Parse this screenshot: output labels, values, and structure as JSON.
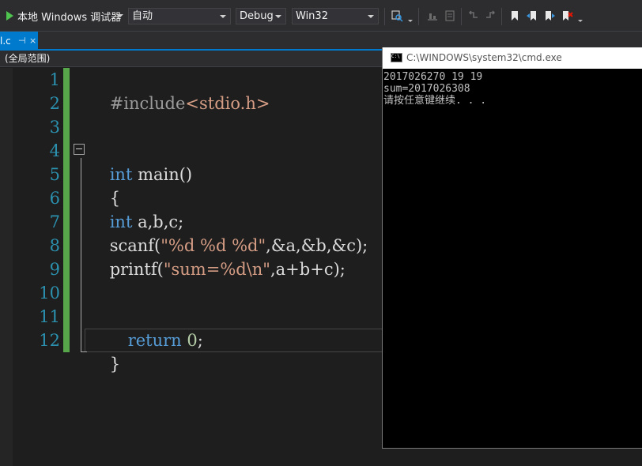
{
  "toolbar": {
    "run_label": "本地 Windows 调试器",
    "config_combo": "自动",
    "build_config": "Debug",
    "platform": "Win32",
    "icons": [
      "find-in-files-icon",
      "format-icon",
      "comment-icon",
      "bookmark-icon",
      "prev-bookmark-icon",
      "next-bookmark-icon",
      "clear-bookmarks-icon"
    ]
  },
  "tab": {
    "file_name": "l.c",
    "pin_glyph": "⊣",
    "close_glyph": "×"
  },
  "navbar": {
    "scope": "(全局范围)"
  },
  "editor": {
    "line_numbers": [
      "1",
      "2",
      "3",
      "4",
      "5",
      "6",
      "7",
      "8",
      "9",
      "10",
      "11",
      "12"
    ],
    "lines": {
      "l1_directive": "#include",
      "l1_header": "<stdio.h>",
      "l4_kw": "int",
      "l4_rest": " main()",
      "l5": "{",
      "l6_kw": "int",
      "l6_rest": " a,b,c;",
      "l7_a": "scanf(",
      "l7_str": "\"%d %d %d\"",
      "l7_b": ",&a,&b,&c);",
      "l8_a": "printf(",
      "l8_str": "\"sum=%d\\n\"",
      "l8_b": ",a+b+c);",
      "l11_kw": "return",
      "l11_num": "0",
      "l11_end": ";",
      "l12": "}"
    }
  },
  "console": {
    "title": "C:\\WINDOWS\\system32\\cmd.exe",
    "icon_text": "C:\\",
    "output": [
      "2017026270 19 19",
      "sum=2017026308",
      "请按任意键继续. . ."
    ]
  },
  "colors": {
    "accent": "#007acc",
    "keyword": "#569cd6",
    "string": "#d69d85",
    "line_number": "#2b91af",
    "change_bar": "#57a64a",
    "run_icon": "#4ec34e"
  }
}
